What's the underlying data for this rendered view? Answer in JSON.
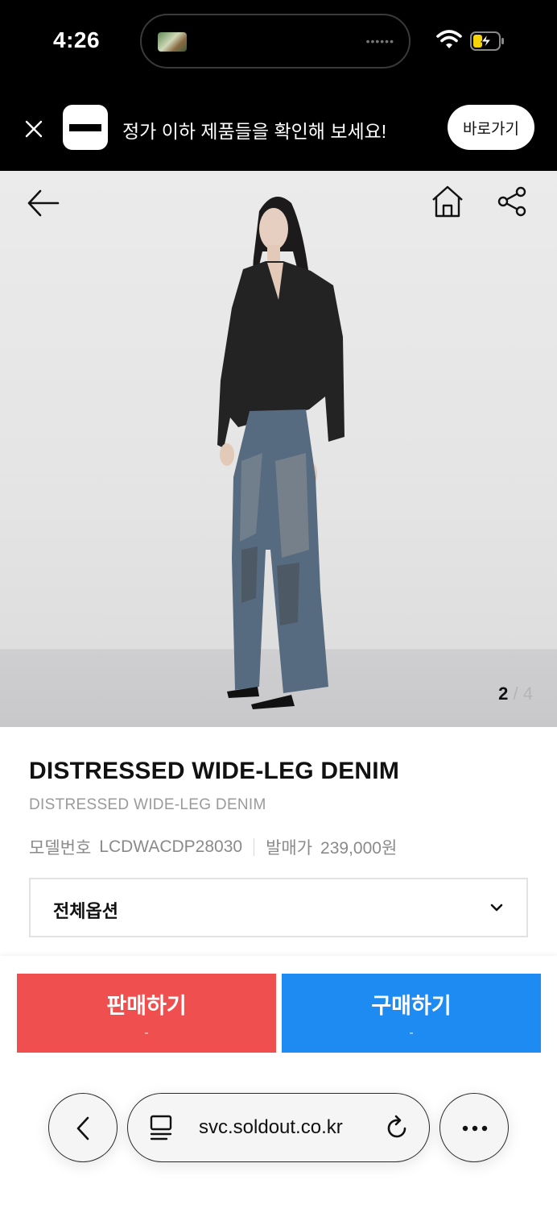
{
  "status_bar": {
    "time": "4:26"
  },
  "banner": {
    "message": "정가 이하 제품들을 확인해 보세요!",
    "cta_label": "바로가기"
  },
  "gallery": {
    "current_page": "2",
    "separator": "/",
    "total_pages": "4"
  },
  "product": {
    "title": "DISTRESSED WIDE-LEG DENIM",
    "subtitle": "DISTRESSED WIDE-LEG DENIM",
    "model_label": "모델번호",
    "model_number": "LCDWACDP28030",
    "release_price_label": "발매가",
    "release_price": "239,000원"
  },
  "options": {
    "label": "전체옵션"
  },
  "actions": {
    "sell_label": "판매하기",
    "sell_price": "-",
    "buy_label": "구매하기",
    "buy_price": "-"
  },
  "browser": {
    "url": "svc.soldout.co.kr"
  },
  "colors": {
    "sell": "#ef4f4f",
    "buy": "#1d8bf2",
    "banner_bg": "#000000"
  }
}
